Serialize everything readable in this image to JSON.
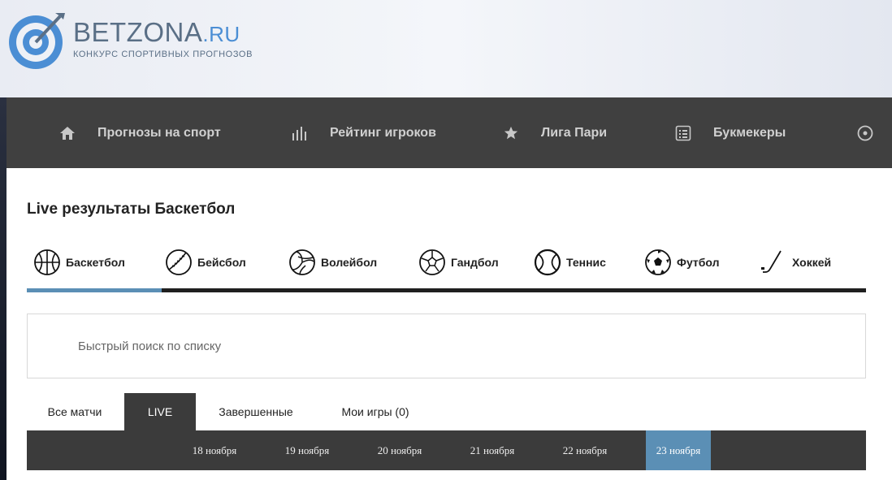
{
  "logo": {
    "name": "BETZONA",
    "tld": ".RU",
    "tagline": "КОНКУРС СПОРТИВНЫХ ПРОГНОЗОВ"
  },
  "nav": {
    "items": [
      {
        "label": "Прогнозы на спорт",
        "icon": "home-icon"
      },
      {
        "label": "Рейтинг игроков",
        "icon": "bar-chart-icon"
      },
      {
        "label": "Лига Пари",
        "icon": "star-icon"
      },
      {
        "label": "Букмекеры",
        "icon": "list-icon"
      }
    ],
    "more_icon": "circle-play-icon"
  },
  "page": {
    "title": "Live результаты Баскетбол"
  },
  "sports": {
    "items": [
      {
        "label": "Баскетбол",
        "icon": "basketball-icon",
        "active": true
      },
      {
        "label": "Бейсбол",
        "icon": "baseball-icon"
      },
      {
        "label": "Волейбол",
        "icon": "volleyball-icon"
      },
      {
        "label": "Гандбол",
        "icon": "handball-icon"
      },
      {
        "label": "Теннис",
        "icon": "tennis-icon"
      },
      {
        "label": "Футбол",
        "icon": "football-icon"
      },
      {
        "label": "Хоккей",
        "icon": "hockey-icon"
      }
    ]
  },
  "search": {
    "placeholder": "Быстрый поиск по списку",
    "value": ""
  },
  "filters": {
    "items": [
      {
        "label": "Все матчи"
      },
      {
        "label": "LIVE",
        "active": true
      },
      {
        "label": "Завершенные"
      },
      {
        "label": "Мои игры (0)"
      }
    ]
  },
  "dates": {
    "items": [
      {
        "label": "18 ноября"
      },
      {
        "label": "19 ноября"
      },
      {
        "label": "20 ноября"
      },
      {
        "label": "21 ноября"
      },
      {
        "label": "22 ноября"
      },
      {
        "label": "23 ноября",
        "active": true
      }
    ]
  },
  "colors": {
    "accent": "#5b8fb5",
    "nav_bg": "#404040",
    "logo_blue": "#4b8ed4"
  }
}
